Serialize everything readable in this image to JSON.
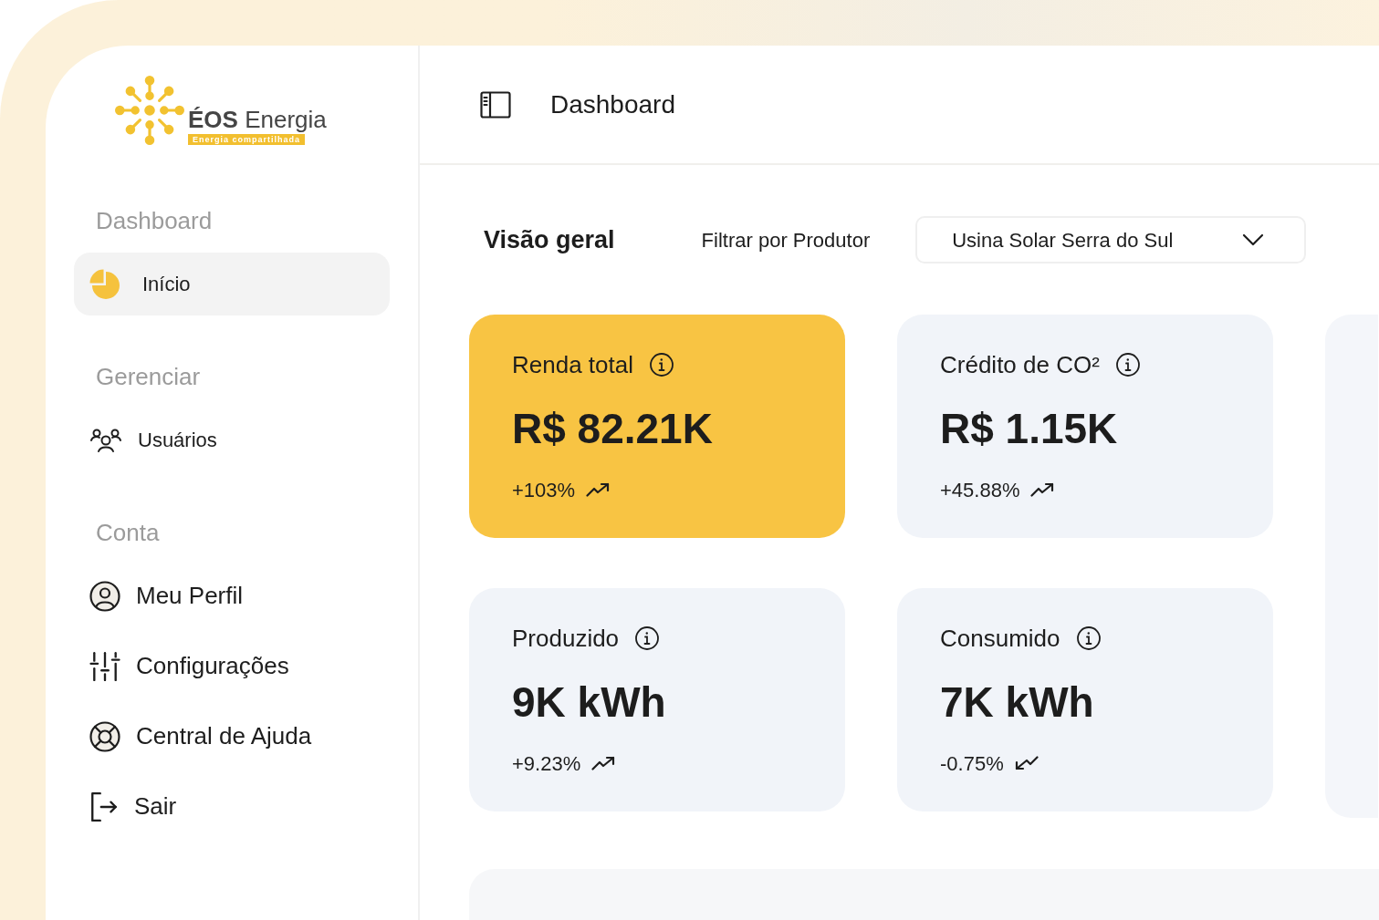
{
  "sidebar": {
    "logo": {
      "wordmark": "**ÉOS** Energia",
      "tagline": "Energia compartilhada"
    },
    "sections": [
      {
        "title": "Dashboard",
        "items": [
          {
            "label": "Início",
            "selected": true
          }
        ]
      },
      {
        "title": "Gerenciar",
        "items": [
          {
            "label": "Usuários",
            "selected": false
          }
        ]
      },
      {
        "title": "Conta",
        "items": [
          {
            "label": "Meu Perfil",
            "selected": false
          },
          {
            "label": "Configurações",
            "selected": false
          },
          {
            "label": "Central de Ajuda",
            "selected": false
          },
          {
            "label": "Sair",
            "selected": false
          }
        ]
      }
    ]
  },
  "header": {
    "title": "Dashboard"
  },
  "overview": {
    "title": "Visão geral",
    "filter_label": "Filtrar por Produtor",
    "filter": {
      "value": "Usina Solar Serra do Sul"
    }
  },
  "cards": [
    {
      "kind": "rising",
      "title": "Renda total",
      "value": "R$ 82.21K",
      "change": "+103%",
      "highlighted": true
    },
    {
      "kind": "rising",
      "title": "Crédito de CO²",
      "value": "R$ 1.15K",
      "change": "+45.88%",
      "highlighted": false
    },
    {
      "kind": "rising",
      "title": "Produzido",
      "value": "9K kWh",
      "change": "+9.23%",
      "highlighted": false
    },
    {
      "kind": "falling",
      "title": "Consumido",
      "value": "7K kWh",
      "change": "-0.75%",
      "highlighted": false
    }
  ]
}
